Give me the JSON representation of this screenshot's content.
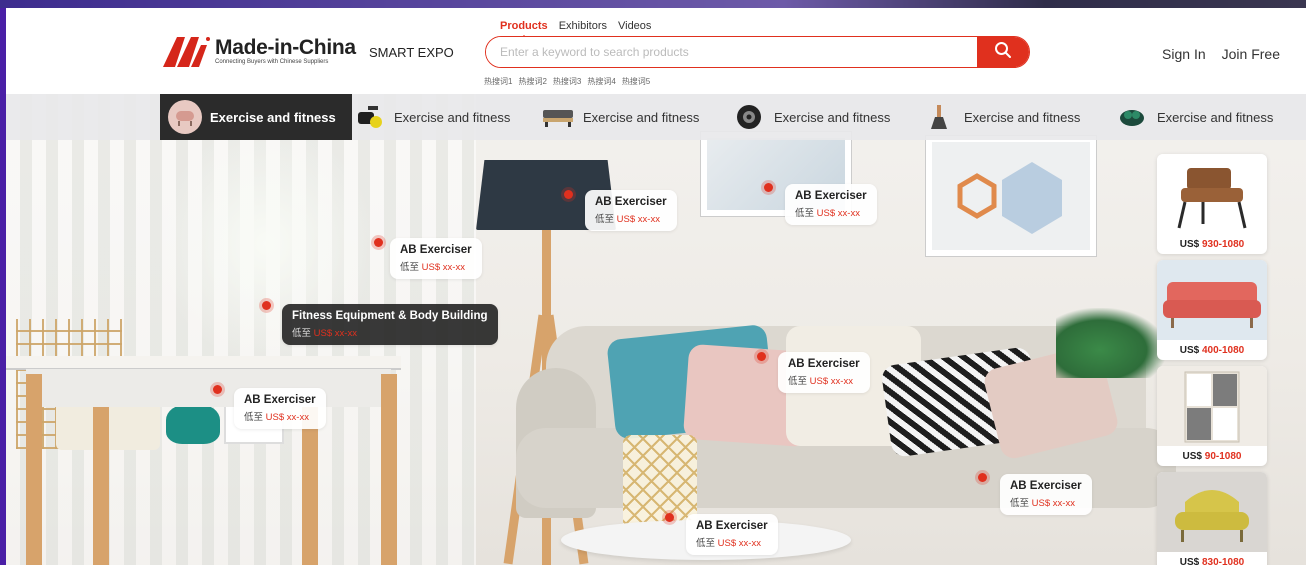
{
  "site": {
    "logo_title": "Made-in-China",
    "logo_subtitle": "Connecting Buyers with Chinese Suppliers",
    "smart_expo": "SMART EXPO"
  },
  "search": {
    "tabs": [
      "Products",
      "Exhibitors",
      "Videos"
    ],
    "active_tab": "Products",
    "placeholder": "Enter a keyword to search products",
    "hot_words": [
      "热搜词1",
      "热搜词2",
      "热搜词3",
      "热搜词4",
      "热搜词5"
    ]
  },
  "auth": {
    "sign_in": "Sign In",
    "join_free": "Join Free"
  },
  "categories": [
    {
      "label": "Exercise and fitness",
      "icon": "chair-icon",
      "active": true
    },
    {
      "label": "Exercise and fitness",
      "icon": "exercise-bike-icon",
      "active": false
    },
    {
      "label": "Exercise and fitness",
      "icon": "bench-icon",
      "active": false
    },
    {
      "label": "Exercise and fitness",
      "icon": "tire-icon",
      "active": false
    },
    {
      "label": "Exercise and fitness",
      "icon": "lamp-icon",
      "active": false
    },
    {
      "label": "Exercise and fitness",
      "icon": "earbuds-icon",
      "active": false
    }
  ],
  "hotspots": [
    {
      "title": "AB Exerciser",
      "price_prefix": "低至",
      "price": "US$ xx-xx"
    },
    {
      "title": "AB Exerciser",
      "price_prefix": "低至",
      "price": "US$ xx-xx"
    },
    {
      "title": "AB Exerciser",
      "price_prefix": "低至",
      "price": "US$ xx-xx"
    },
    {
      "title": "Fitness Equipment & Body Building",
      "price_prefix": "低至",
      "price": "US$ xx-xx"
    },
    {
      "title": "AB Exerciser",
      "price_prefix": "低至",
      "price": "US$ xx-xx"
    },
    {
      "title": "AB Exerciser",
      "price_prefix": "低至",
      "price": "US$ xx-xx"
    },
    {
      "title": "AB Exerciser",
      "price_prefix": "低至",
      "price": "US$ xx-xx"
    },
    {
      "title": "AB Exerciser",
      "price_prefix": "低至",
      "price": "US$ xx-xx"
    }
  ],
  "product_cards": [
    {
      "currency": "US$",
      "range": "930-1080",
      "image": "armchair-image"
    },
    {
      "currency": "US$",
      "range": "400-1080",
      "image": "sofa-image"
    },
    {
      "currency": "US$",
      "range": "90-1080",
      "image": "cabinet-image"
    },
    {
      "currency": "US$",
      "range": "830-1080",
      "image": "yellow-chair-image"
    }
  ],
  "colors": {
    "brand_red": "#e0301e",
    "dark_tab": "#2b2b2b",
    "page_border": "#4a1fa6"
  }
}
